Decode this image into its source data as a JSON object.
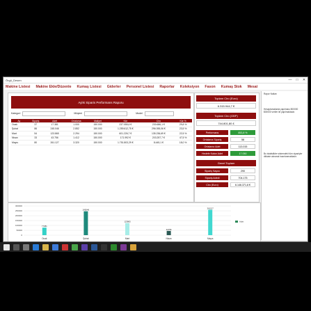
{
  "window": {
    "title": "Örgü_Desen"
  },
  "controls": {
    "min": "—",
    "max": "□",
    "close": "✕"
  },
  "menu": [
    "Makine Listesi",
    "Makine Ekle/Düzenle",
    "Kumaş Listesi",
    "Giderler",
    "Personel Listesi",
    "Raporlar",
    "Koleksiyon",
    "Fason",
    "Kumaş Stok",
    "Mesai"
  ],
  "report": {
    "title": "Aylık Siparis Performans Raporu",
    "filters": {
      "kategori": "Kategori",
      "musteri": "Müşteri",
      "model": "Model"
    },
    "columns": [
      "Ay",
      "Sipariş",
      "Adet",
      "Ortalama",
      "Maliyet",
      "Kâr",
      "Ciro",
      "Kâr %"
    ],
    "rows": [
      [
        "Ocak",
        "37",
        "17.381",
        "1.000",
        "150.000",
        "237.055,4 €",
        "230.686,1 €",
        "29,8 %"
      ],
      [
        "Şubat",
        "86",
        "245.046",
        "2.852",
        "150.000",
        "1.259.612,75 €",
        "296.055,06 €",
        "23,5 %"
      ],
      [
        "Mart",
        "54",
        "123.865",
        "2.294",
        "150.000",
        "601.226,7 €",
        "135.236,69 €",
        "22,5 %"
      ],
      [
        "Nisan",
        "33",
        "43.756",
        "1.412",
        "150.000",
        "171.992 €",
        "203.257,7 €",
        "47,5 %"
      ],
      [
        "Mayıs",
        "80",
        "261.127",
        "3.320",
        "150.000",
        "1.751.803,29 €",
        "8.445,1 €",
        "18,0 %"
      ]
    ]
  },
  "summary": {
    "toplam_ciro_label": "Toplam Ciro (Euro)",
    "toplam_ciro_value": "6.315.944,7 €",
    "toplam_ciro_gbp_label": "Toplam Ciro (GBP)",
    "toplam_ciro_gbp_value": "744.801,80 £",
    "kv": [
      {
        "k": "Performans",
        "v": "853,8 %",
        "green": true
      },
      {
        "k": "Ortalama Sipariş",
        "v": "58",
        "green": false
      },
      {
        "k": "Ortalama Adet",
        "v": "113.015",
        "green": false
      },
      {
        "k": "Hedefe Kalan Adet",
        "v": "17.050",
        "green": true
      }
    ],
    "genel_label": "Genel Toplam",
    "genel": [
      {
        "k": "Sipariş Sayısı",
        "v": "290"
      },
      {
        "k": "Sipariş Adedi",
        "v": "704.175"
      },
      {
        "k": "Ciro (Euro)",
        "v": "6.146.371,8 €"
      }
    ]
  },
  "side_notes": {
    "heading": "Rapor Notları",
    "p1": "Hesaplamalarda yapılması 800000 $00000 veriler ile yapılmaktadır.",
    "p2": "Bu istatistikler sistemdeki tüm siparişler dikkate alınarak hazırlanmaktadır."
  },
  "chart_data": {
    "type": "bar",
    "categories": [
      "Ocak",
      "Şubat",
      "Mart",
      "Nisan",
      "Mayıs"
    ],
    "values": [
      77381,
      245046,
      123865,
      43756,
      261127
    ],
    "bar_labels": [
      "77381",
      "245046",
      "123865",
      "43756",
      "261127"
    ],
    "ylim": [
      0,
      300000
    ],
    "yticks": [
      0,
      50000,
      100000,
      150000,
      200000,
      250000,
      300000
    ],
    "legend": "Adet",
    "colors": [
      "#34d1c7",
      "#1e8a7c",
      "#a7ede8",
      "#2b5a55",
      "#41d8d0"
    ]
  }
}
